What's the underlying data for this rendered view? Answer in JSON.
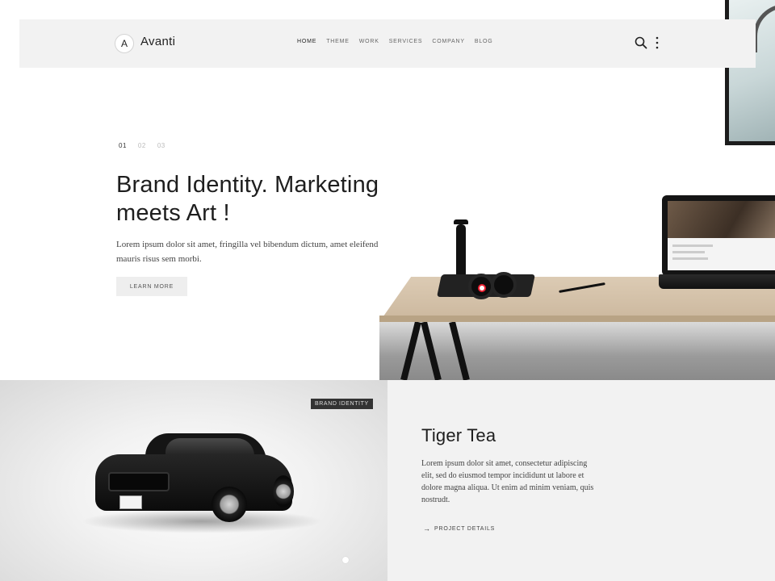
{
  "brand": {
    "logo_letter": "A",
    "name": "Avanti"
  },
  "nav": {
    "items": [
      {
        "label": "HOME",
        "active": true
      },
      {
        "label": "THEME",
        "active": false
      },
      {
        "label": "WORK",
        "active": false
      },
      {
        "label": "SERVICES",
        "active": false
      },
      {
        "label": "COMPANY",
        "active": false
      },
      {
        "label": "BLOG",
        "active": false
      }
    ],
    "icons": [
      "search-icon",
      "more-vertical-icon"
    ]
  },
  "hero": {
    "pager": [
      {
        "label": "01",
        "active": true
      },
      {
        "label": "02",
        "active": false
      },
      {
        "label": "03",
        "active": false
      }
    ],
    "title": "Brand Identity. Marketing meets Art !",
    "text": "Lorem ipsum dolor sit amet, fringilla vel bibendum dictum, amet eleifend mauris risus sem morbi.",
    "button_label": "LEARN MORE"
  },
  "project": {
    "badge": "BRAND IDENTITY",
    "title": "Tiger Tea",
    "text": "Lorem ipsum dolor sit amet, consectetur adipiscing elit, sed do eiusmod tempor incididunt ut labore et dolore magna aliqua. Ut enim ad minim veniam, quis nostrudt.",
    "link_label": "PROJECT DETAILS",
    "link_icon": "arrow-right-icon"
  },
  "colors": {
    "header_bg": "#f2f2f2",
    "text_dark": "#1e1e1e",
    "badge_bg": "#333333",
    "panel_bg": "#f2f2f2"
  }
}
